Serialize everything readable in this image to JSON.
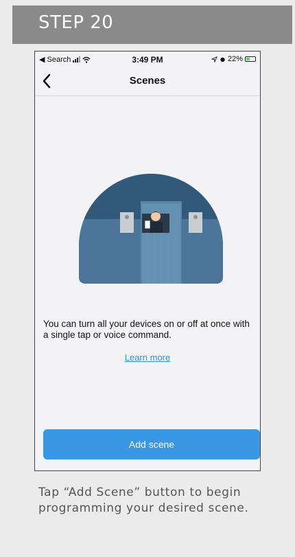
{
  "step": {
    "title": "STEP 20"
  },
  "status_bar": {
    "back_label": "◀ Search",
    "time": "3:49 PM",
    "battery_text": "22%"
  },
  "nav": {
    "back_icon": "chevron-left-icon",
    "title": "Scenes"
  },
  "content": {
    "description": "You can turn all your devices on or off at once with a single tap or voice command.",
    "learn_more": "Learn more",
    "add_button": "Add scene"
  },
  "caption": "Tap “Add Scene” button to begin programming your desired scene.",
  "colors": {
    "header_bg": "#8a8a8a",
    "accent": "#3a97e4",
    "link": "#2f8ee0",
    "illustration": "#3f6a8c"
  }
}
